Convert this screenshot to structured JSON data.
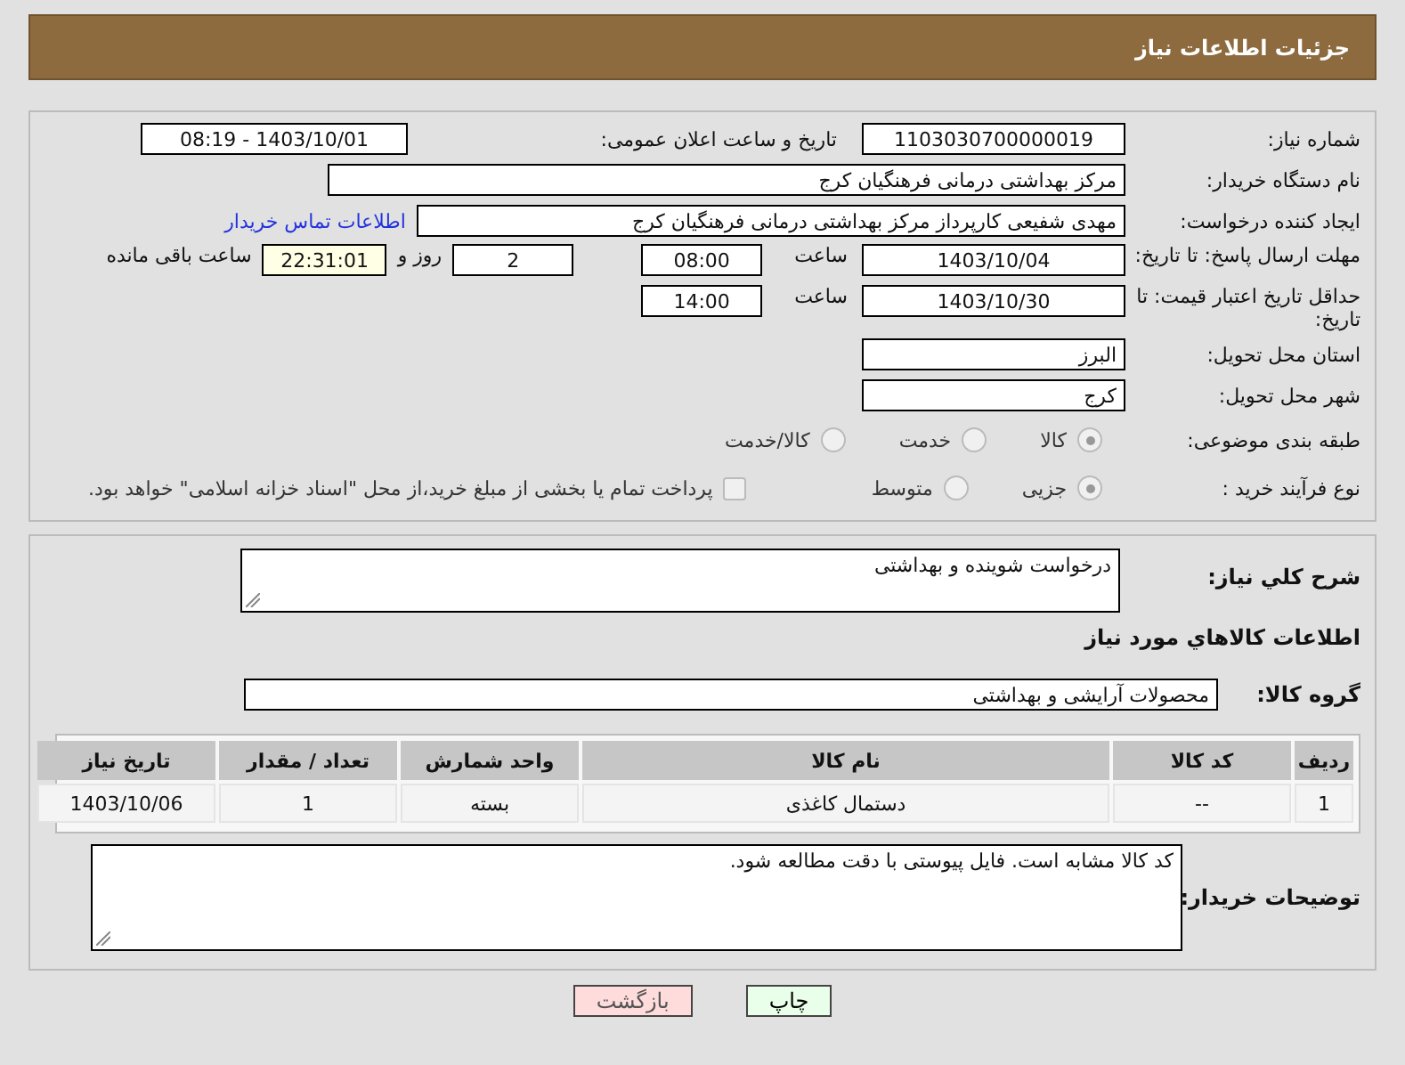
{
  "header": {
    "title": "جزئیات اطلاعات نیاز"
  },
  "details": {
    "need_number": {
      "label": "شماره نیاز:",
      "value": "1103030700000019"
    },
    "announce": {
      "label": "تاریخ و ساعت اعلان عمومی:",
      "value": "1403/10/01 - 08:19"
    },
    "buyer_org": {
      "label": "نام دستگاه خریدار:",
      "value": "مرکز بهداشتی درمانی فرهنگیان کرج"
    },
    "requester": {
      "label": "ایجاد کننده درخواست:",
      "value": "مهدی شفیعی کارپرداز مرکز بهداشتی درمانی فرهنگیان کرج",
      "link": "اطلاعات تماس خریدار"
    },
    "deadline": {
      "label": "مهلت ارسال پاسخ: تا تاریخ:",
      "date": "1403/10/04",
      "time_label": "ساعت",
      "time": "08:00",
      "days": "2",
      "days_label": "روز و",
      "remaining": "22:31:01",
      "remaining_label": "ساعت باقی مانده"
    },
    "validity": {
      "label": "حداقل تاریخ اعتبار قیمت: تا تاریخ:",
      "date": "1403/10/30",
      "time_label": "ساعت",
      "time": "14:00"
    },
    "province": {
      "label": "استان محل تحویل:",
      "value": "البرز"
    },
    "city": {
      "label": "شهر محل تحویل:",
      "value": "کرج"
    },
    "category": {
      "label": "طبقه بندی موضوعی:",
      "options": [
        {
          "label": "کالا",
          "selected": true,
          "disabled": true
        },
        {
          "label": "خدمت",
          "selected": false,
          "disabled": true
        },
        {
          "label": "کالا/خدمت",
          "selected": false,
          "disabled": true
        }
      ]
    },
    "process": {
      "label": "نوع فرآیند خرید :",
      "options": [
        {
          "label": "جزیی",
          "selected": true,
          "disabled": true
        },
        {
          "label": "متوسط",
          "selected": false,
          "disabled": true
        }
      ],
      "treasury": {
        "label": "پرداخت تمام یا بخشی از مبلغ خرید،از محل \"اسناد خزانه اسلامی\" خواهد بود.",
        "checked": false,
        "disabled": true
      }
    }
  },
  "goods": {
    "summary": {
      "label": "شرح كلي نياز:",
      "value": "درخواست شوینده و بهداشتی"
    },
    "heading": "اطلاعات كالاهاي مورد نياز",
    "group": {
      "label": "گروه کالا:",
      "value": "محصولات آرایشی و بهداشتی"
    },
    "table": {
      "columns": [
        "ردیف",
        "کد کالا",
        "نام کالا",
        "واحد شمارش",
        "تعداد / مقدار",
        "تاریخ نیاز"
      ],
      "rows": [
        [
          "1",
          "--",
          "دستمال کاغذی",
          "بسته",
          "1",
          "1403/10/06"
        ]
      ]
    },
    "notes": {
      "label": "توضیحات خریدار:",
      "value": "کد کالا مشابه است. فایل پیوستی با دقت مطالعه شود."
    }
  },
  "buttons": [
    {
      "label": "چاپ",
      "kind": "print"
    },
    {
      "label": "بازگشت",
      "kind": "back"
    }
  ]
}
